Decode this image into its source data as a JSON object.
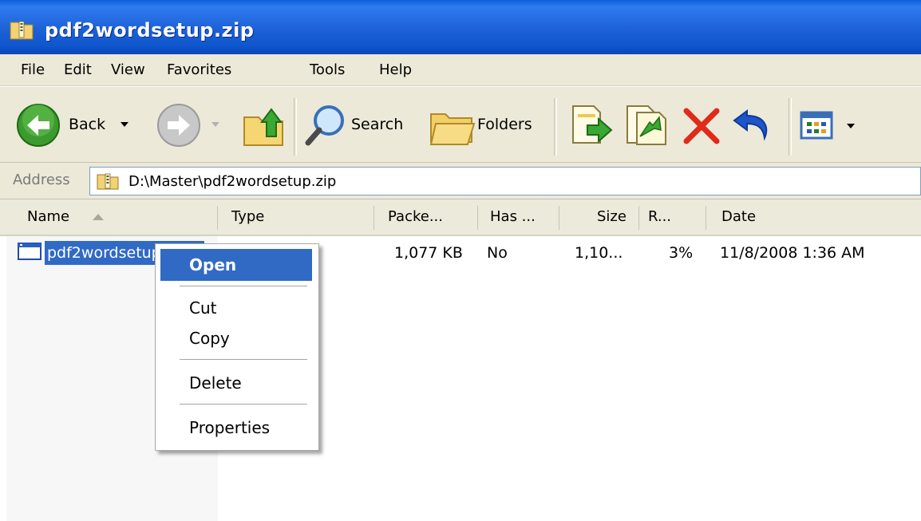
{
  "window": {
    "title": "pdf2wordsetup.zip"
  },
  "menu": [
    "File",
    "Edit",
    "View",
    "Favorites",
    "Tools",
    "Help"
  ],
  "toolbar": {
    "back_label": "Back",
    "search_label": "Search",
    "folders_label": "Folders",
    "icons": [
      "back-arrow-icon",
      "dropdown-arrow-icon",
      "forward-arrow-icon",
      "up-folder-icon",
      "search-icon",
      "folders-icon",
      "extract-icon",
      "add-icon",
      "delete-icon",
      "undo-icon",
      "views-icon"
    ]
  },
  "address": {
    "label": "Address",
    "path": "D:\\Master\\pdf2wordsetup.zip"
  },
  "columns": [
    "Name",
    "Type",
    "Packe...",
    "Has ...",
    "Size",
    "R...",
    "Date"
  ],
  "files": [
    {
      "name": "pdf2wordsetup",
      "type": "",
      "packed": "1,077 KB",
      "has_password": "No",
      "size": "1,10...",
      "ratio": "3%",
      "date": "11/8/2008 1:36 AM"
    }
  ],
  "context_menu": {
    "items": [
      "Open",
      "Cut",
      "Copy",
      "Delete",
      "Properties"
    ],
    "highlighted": "Open"
  },
  "colors": {
    "titlebar": "#0a5fd8",
    "selection": "#316ac5",
    "chrome": "#ece9d8"
  }
}
